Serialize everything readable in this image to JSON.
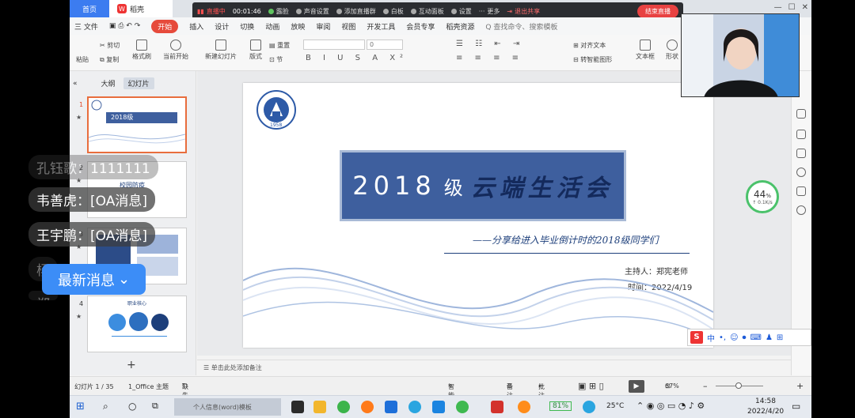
{
  "titlebar": {
    "tab_home": "首页",
    "tab_doc": "稻壳"
  },
  "livebar": {
    "status": "直播中",
    "time": "00:01:46",
    "beauty": "露脸",
    "audio": "声音设置",
    "add_live": "添加直播群",
    "whiteboard": "白板",
    "interact": "互动面板",
    "settings": "设置",
    "more": "更多",
    "exit_share": "退出共享",
    "end_live": "结束直播"
  },
  "menu": {
    "file": "三 文件",
    "start": "开始",
    "items": [
      "插入",
      "设计",
      "切换",
      "动画",
      "放映",
      "审阅",
      "视图",
      "开发工具",
      "会员专享",
      "稻壳资源"
    ],
    "search": "Q 查找命令、搜索模板"
  },
  "ribbon": {
    "paste": "粘贴",
    "cut": "剪切",
    "copy": "复制",
    "format_painter": "格式刷",
    "from_current": "当前开始",
    "new_slide": "新建幻灯片",
    "layout": "版式",
    "section": "节",
    "reset": "重置",
    "font_size": "0",
    "align_text": "对齐文本",
    "smart_art": "转智能图形",
    "textbox": "文本框",
    "shape": "形状"
  },
  "leftpanel": {
    "outline": "大纲",
    "slides": "幻灯片",
    "thumbs": [
      {
        "num": "1",
        "title": "2018级"
      },
      {
        "num": "2",
        "title": "校园防疫"
      },
      {
        "num": "3",
        "title": ""
      },
      {
        "num": "4",
        "title": "职业核心"
      }
    ]
  },
  "slide": {
    "school_seal": "SCHOOL OF CIVIL ENGINEERING",
    "seal_year": "1958",
    "title_year": "2018",
    "title_ji": "级",
    "title_main": "云端生活会",
    "subtitle": "——分享给进入毕业倒计时的2018级同学们",
    "host": "主持人：郑宪老师",
    "date": "时间：2022/4/19"
  },
  "notes_placeholder": "单击此处添加备注",
  "statusbar": {
    "slide_info": "幻灯片 1 / 35",
    "theme": "1_Office 主题",
    "missing_font": "缺失字体",
    "smart_beautify": "智能美化",
    "notes": "备注",
    "comments": "批注",
    "zoom": "67%"
  },
  "gauge": {
    "percent": "44",
    "unit": "%",
    "speed": "↑ 0.1K/s"
  },
  "chat": [
    {
      "text": "孔钰歌：1111111",
      "faded": true
    },
    {
      "text": "韦善虎：[OA消息]",
      "faded": false
    },
    {
      "text": "王宇鹏：[OA消息]",
      "faded": false
    },
    {
      "text": "杨",
      "faded": true
    },
    {
      "text": "郑",
      "faded": true
    }
  ],
  "new_messages": "最新消息",
  "ime": {
    "label": "中"
  },
  "taskbar": {
    "task_label": "个人信息(word)模板",
    "battery": "81%",
    "temperature": "25°C",
    "time": "14:58",
    "date": "2022/4/20"
  },
  "colors": {
    "accent_blue": "#3c7cf0",
    "live_red": "#e84242",
    "slide_title_bg": "#3e5f9e",
    "new_msg_bg": "#3c8df7"
  }
}
